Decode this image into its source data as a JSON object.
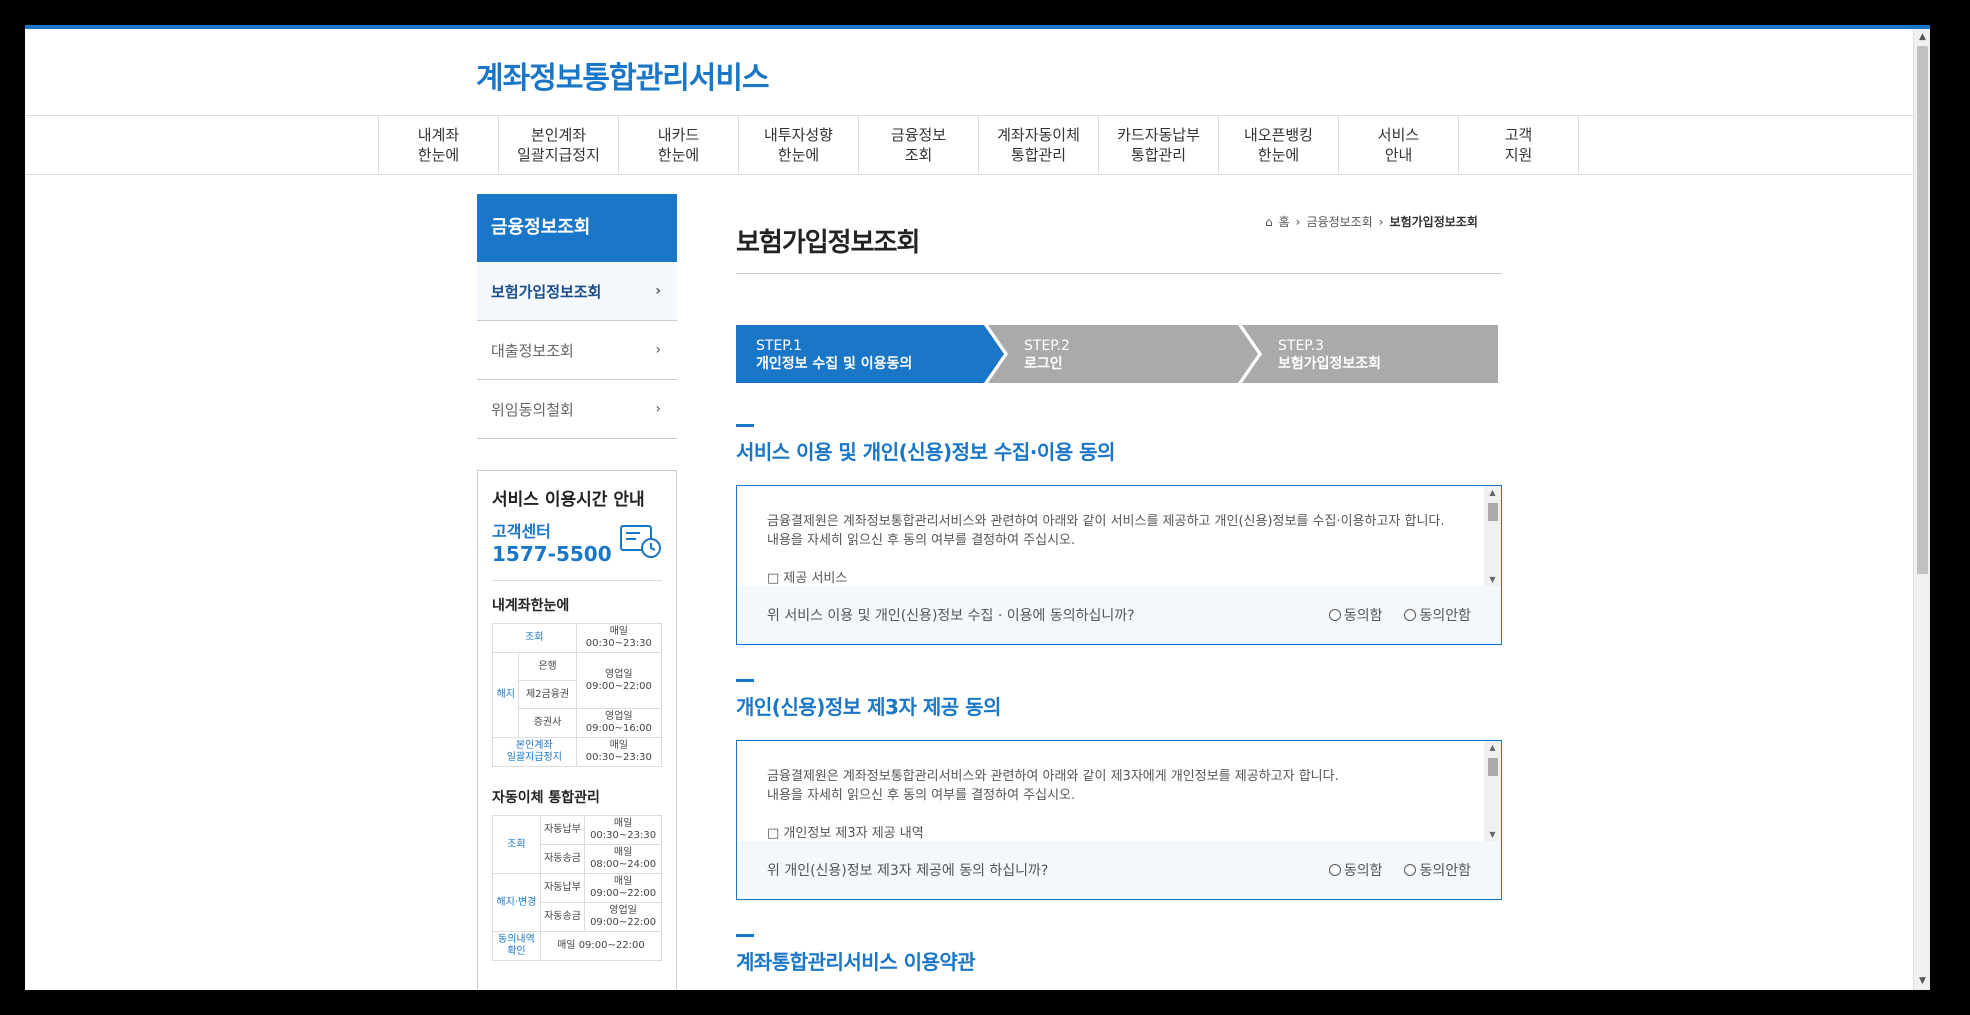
{
  "site": {
    "title": "계좌정보통합관리서비스"
  },
  "gnb": [
    {
      "line1": "내계좌",
      "line2": "한눈에"
    },
    {
      "line1": "본인계좌",
      "line2": "일괄지급정지"
    },
    {
      "line1": "내카드",
      "line2": "한눈에"
    },
    {
      "line1": "내투자성향",
      "line2": "한눈에"
    },
    {
      "line1": "금융정보",
      "line2": "조회"
    },
    {
      "line1": "계좌자동이체",
      "line2": "통합관리"
    },
    {
      "line1": "카드자동납부",
      "line2": "통합관리"
    },
    {
      "line1": "내오픈뱅킹",
      "line2": "한눈에"
    },
    {
      "line1": "서비스",
      "line2": "안내"
    },
    {
      "line1": "고객",
      "line2": "지원"
    }
  ],
  "lnb": {
    "title": "금융정보조회",
    "items": [
      {
        "label": "보험가입정보조회"
      },
      {
        "label": "대출정보조회"
      },
      {
        "label": "위임동의철회"
      }
    ]
  },
  "hours": {
    "title": "서비스 이용시간 안내",
    "cc_label": "고객센터",
    "cc_number": "1577-5500",
    "sec1": {
      "title": "내계좌한눈에",
      "r1c1": "조회",
      "r1c3": "매일",
      "r1c3b": "00:30~23:30",
      "r2c1": "해지",
      "r2c2": "은행",
      "r2c3": "영업일",
      "r2c3b": "09:00~22:00",
      "r3c2": "제2금융권",
      "r4c2": "증권사",
      "r4c3": "영업일",
      "r4c3b": "09:00~16:00",
      "r5c1": "본인계좌",
      "r5c1b": "일괄지급정지",
      "r5c3": "매일",
      "r5c3b": "00:30~23:30"
    },
    "sec2": {
      "title": "자동이체 통합관리",
      "r1c1": "조회",
      "r1c2": "자동납부",
      "r1c3": "매일",
      "r1c3b": "00:30~23:30",
      "r2c2": "자동송금",
      "r2c3": "매일",
      "r2c3b": "08:00~24:00",
      "r3c1": "해지·변경",
      "r3c2": "자동납부",
      "r3c3": "매일",
      "r3c3b": "09:00~22:00",
      "r4c2": "자동송금",
      "r4c3": "영업일",
      "r4c3b": "09:00~22:00",
      "r5c1": "동의내역",
      "r5c1b": "확인",
      "r5c3": "매일 09:00~22:00"
    }
  },
  "breadcrumb": {
    "home": "홈",
    "level1": "금융정보조회",
    "current": "보험가입정보조회"
  },
  "page_title": "보험가입정보조회",
  "steps": [
    {
      "num": "STEP.1",
      "label": "개인정보 수집 및 이용동의"
    },
    {
      "num": "STEP.2",
      "label": "로그인"
    },
    {
      "num": "STEP.3",
      "label": "보험가입정보조회"
    }
  ],
  "sections": [
    {
      "title": "서비스 이용 및 개인(신용)정보 수집·이용 동의",
      "line1": "금융결제원은 계좌정보통합관리서비스와 관련하여 아래와 같이 서비스를 제공하고 개인(신용)정보를 수집·이용하고자 합니다.",
      "line2": "내용을 자세히 읽으신 후 동의 여부를 결정하여 주십시오.",
      "line3": "□ 제공 서비스",
      "question": "위 서비스 이용 및 개인(신용)정보 수집 · 이용에 동의하십니까?",
      "agree": "동의함",
      "disagree": "동의안함"
    },
    {
      "title": "개인(신용)정보 제3자 제공 동의",
      "line1": "금융결제원은 계좌정보통합관리서비스와 관련하여 아래와 같이 제3자에게 개인정보를 제공하고자 합니다.",
      "line2": "내용을 자세히 읽으신 후 동의 여부를 결정하여 주십시오.",
      "line3": "□ 개인정보 제3자 제공 내역",
      "question": "위 개인(신용)정보 제3자 제공에 동의 하십니까?",
      "agree": "동의함",
      "disagree": "동의안함"
    },
    {
      "title": "계좌통합관리서비스 이용약관"
    }
  ]
}
